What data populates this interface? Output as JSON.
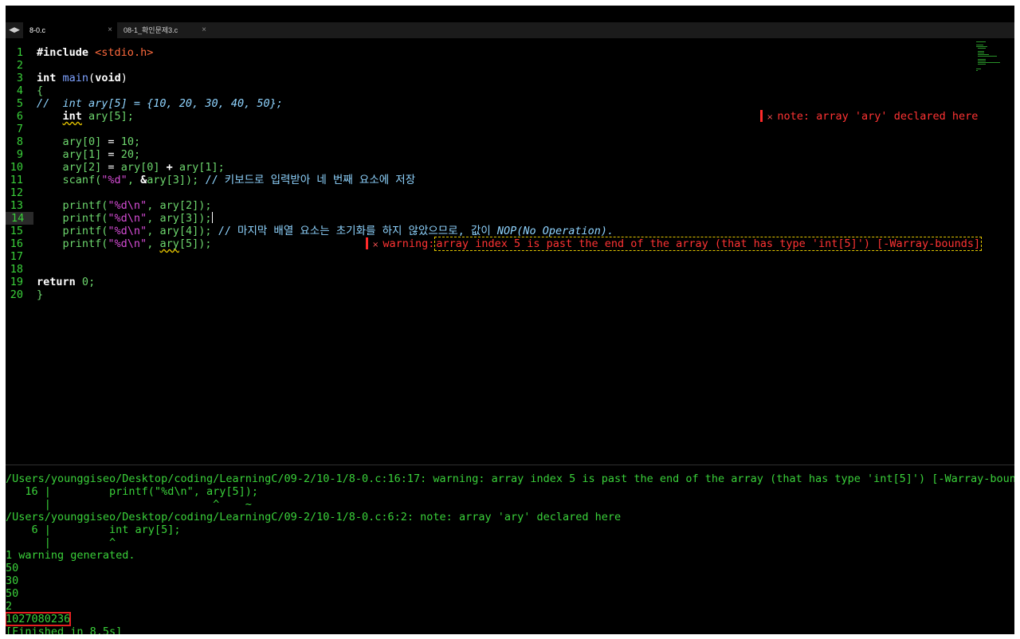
{
  "tabs": [
    {
      "label": "8-0.c",
      "active": true
    },
    {
      "label": "08-1_확인문제3.c",
      "active": false
    }
  ],
  "nav": {
    "back": "◀",
    "forward": "▶"
  },
  "tab_close_glyph": "×",
  "editor": {
    "line_numbers": [
      "1",
      "2",
      "3",
      "4",
      "5",
      "6",
      "7",
      "8",
      "9",
      "10",
      "11",
      "12",
      "13",
      "14",
      "15",
      "16",
      "17",
      "18",
      "19",
      "20"
    ],
    "current_line": "14",
    "lines": {
      "l1": {
        "kw": "#include",
        "inc": "<stdio.h>"
      },
      "l3": {
        "type": "int",
        "fn": "main",
        "open": "(",
        "param": "void",
        "close": ")"
      },
      "l4": "{",
      "l5": "//  int ary[5] = {10, 20, 30, 40, 50};",
      "l6": {
        "type": "int",
        "rest": " ary[5];"
      },
      "l8": {
        "pre": "ary[0]",
        "op": " = ",
        "num": "10",
        "end": ";"
      },
      "l9": {
        "pre": "ary[1]",
        "op": " = ",
        "num": "20",
        "end": ";"
      },
      "l10": {
        "a": "ary[2]",
        "eq": " = ",
        "b": "ary[0]",
        "plus": " + ",
        "c": "ary[1]",
        "end": ";"
      },
      "l11": {
        "fn": "scanf(",
        "str": "\"%d\"",
        "mid": ", ",
        "amp": "&",
        "arg": "ary[3]",
        "end": "); ",
        "comment": "// 키보드로 입력받아 네 번째 요소에 저장"
      },
      "l13": {
        "fn": "printf(",
        "str": "\"%d\\n\"",
        "mid": ", ",
        "arg": "ary[2]",
        "end": ");"
      },
      "l14": {
        "fn": "printf(",
        "str": "\"%d\\n\"",
        "mid": ", ",
        "arg": "ary[3]",
        "end": ");"
      },
      "l15": {
        "fn": "printf(",
        "str": "\"%d\\n\"",
        "mid": ", ",
        "arg": "ary[4]",
        "end": "); ",
        "comment": "// 마지막 배열 요소는 초기화를 하지 않았으므로, 값이 ",
        "comment_it": "NOP(No Operation)."
      },
      "l16": {
        "fn": "printf(",
        "str": "\"%d\\n\"",
        "mid": ", ",
        "arg_pre": "ary",
        "arg_sq": "[5]",
        "end": ");"
      },
      "l19": {
        "kw": "return",
        "num": "0",
        "end": ";"
      },
      "l20": "}"
    },
    "annotations": {
      "note": {
        "x": "×",
        "text": "note: array 'ary' declared here"
      },
      "warning": {
        "x": "×",
        "label": "warning:",
        "text": "array index 5 is past the end of the array (that has type 'int[5]') [-Warray-bounds]"
      }
    }
  },
  "output": {
    "lines": [
      "/Users/younggiseo/Desktop/coding/LearningC/09-2/10-1/8-0.c:16:17: warning: array index 5 is past the end of the array (that has type 'int[5]') [-Warray-bounds]",
      "   16 |         printf(\"%d\\n\", ary[5]);",
      "      |                         ^    ~",
      "/Users/younggiseo/Desktop/coding/LearningC/09-2/10-1/8-0.c:6:2: note: array 'ary' declared here",
      "    6 |         int ary[5];",
      "      |         ^",
      "1 warning generated.",
      "50",
      "30",
      "50",
      "2",
      "1027080236",
      "[Finished in 8.5s]"
    ],
    "highlighted_index": 11
  },
  "colors": {
    "background": "#000000",
    "line_numbers": "#3ad13a",
    "output_text": "#3ad13a",
    "error": "#ff3333",
    "warning_box": "#e6c800",
    "highlight_box": "#e52020"
  }
}
